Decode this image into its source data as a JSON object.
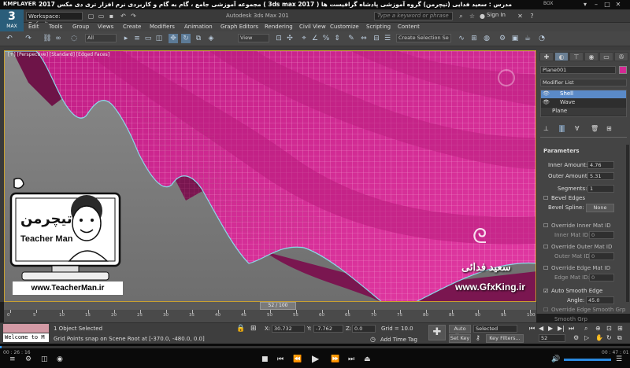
{
  "player": {
    "logo": "KMPLAYER",
    "title": "مجموعه آموزشی جامع ، گام به گام و کاربردی نرم افزار تری دی مکس 2017  ( 3ds max 2017 )  مدرس : سعید فدایی (تیچرمن) گروه آموزشی پادشاه گرافیست ها",
    "box_label": "BOX",
    "time_elapsed": "00 : 26 : 16",
    "time_total": "00 : 47 : 01"
  },
  "app": {
    "logo_number": "3",
    "logo_text": "MAX",
    "workspace": "Workspace: Default",
    "document": "Autodesk 3ds Max 201",
    "search_placeholder": "Type a keyword or phrase",
    "sign_in": "Sign In"
  },
  "menu": [
    "Edit",
    "Tools",
    "Group",
    "Views",
    "Create",
    "Modifiers",
    "Animation",
    "Graph Editors",
    "Rendering",
    "Civil View",
    "Customize",
    "Scripting",
    "Content"
  ],
  "toolbar": {
    "selection_filter": "All",
    "ref_coord": "View",
    "create_selection_set": "Create Selection Se"
  },
  "viewport": {
    "label": "[+] [Perspective] [Standard] [Edged Faces]"
  },
  "command_panel": {
    "object_name": "Plane001",
    "modifier_list": "Modifier List",
    "stack": [
      "Shell",
      "Wave",
      "Plane"
    ],
    "rollout_title": "Parameters",
    "params": [
      {
        "label": "Inner Amount:",
        "value": "4.76"
      },
      {
        "label": "Outer Amount:",
        "value": "5.31"
      },
      {
        "label": "Segments:",
        "value": "1"
      }
    ],
    "bevel_edges": "Bevel Edges",
    "bevel_spline_label": "Bevel Spline:",
    "bevel_spline_value": "None",
    "override_inner": "Override Inner Mat ID",
    "inner_mat_id": "Inner Mat ID:",
    "inner_mat_val": "0",
    "override_outer": "Override Outer Mat ID",
    "outer_mat_id": "Outer Mat ID:",
    "outer_mat_val": "0",
    "override_edge": "Override Edge Mat ID",
    "edge_mat_id": "Edge Mat ID:",
    "edge_mat_val": "0",
    "auto_smooth": "Auto Smooth Edge",
    "angle_label": "Angle:",
    "angle_value": "45.0",
    "override_smooth": "Override Edge Smooth Grp",
    "smooth_grp": "Smooth Grp"
  },
  "timeline": {
    "frame": "52 / 100",
    "ticks": [
      "0",
      "5",
      "10",
      "15",
      "20",
      "25",
      "30",
      "35",
      "40",
      "45",
      "50",
      "55",
      "60",
      "65",
      "70",
      "75",
      "80",
      "85",
      "90",
      "95",
      "100"
    ]
  },
  "status": {
    "maxscript": "Welcome to M",
    "selected": "1 Object Selected",
    "prompt": "Grid Points snap on Scene Root at [-370.0, -480.0, 0.0]",
    "x_label": "X:",
    "x_value": "30.732",
    "y_label": "Y:",
    "y_value": "-7.762",
    "z_label": "Z:",
    "z_value": "0.0",
    "grid": "Grid = 10.0",
    "add_time_tag": "Add Time Tag",
    "auto_key": "Auto Key",
    "selected_dd": "Selected",
    "set_key": "Set Key",
    "key_filters": "Key Filters...",
    "frame_field": "52"
  },
  "overlay": {
    "teacherman_fa": "تیچرمن",
    "teacherman_en": "Teacher Man",
    "teacherman_web": "www.TeacherMan.ir",
    "gfx_name": "سعید فدائی",
    "gfx_web": "www.GfxKing.ir"
  },
  "colors": {
    "mesh_pink": "#d42a94",
    "mesh_dark": "#7a1650",
    "selection_cyan": "#8ad8e8",
    "accent_blue": "#5a8ac8"
  }
}
